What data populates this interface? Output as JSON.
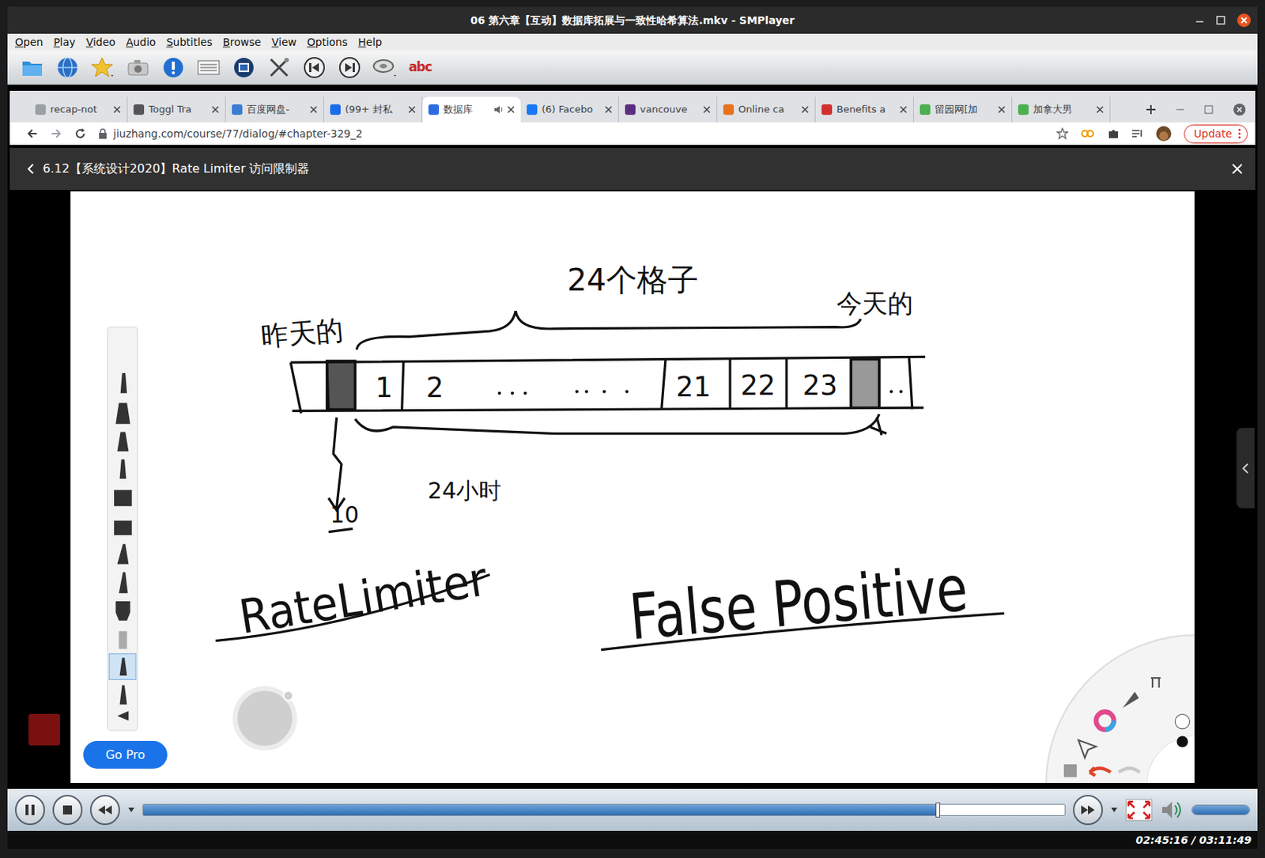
{
  "window": {
    "title": "06 第六章【互动】数据库拓展与一致性哈希算法.mkv - SMPlayer"
  },
  "menu": [
    "Open",
    "Play",
    "Video",
    "Audio",
    "Subtitles",
    "Browse",
    "View",
    "Options",
    "Help"
  ],
  "toolbar": {
    "subtitle_icon_text": "abc"
  },
  "browser": {
    "tabs": [
      {
        "label": "recap-not",
        "selected": false,
        "audio": false,
        "color": "#9aa0a6"
      },
      {
        "label": "Toggl Tra",
        "selected": false,
        "audio": false,
        "color": "#555555"
      },
      {
        "label": "百度网盘-",
        "selected": false,
        "audio": false,
        "color": "#3a7bd5"
      },
      {
        "label": "(99+ 封私",
        "selected": false,
        "audio": false,
        "color": "#1a6ce8"
      },
      {
        "label": "数据库",
        "selected": true,
        "audio": true,
        "color": "#2b6de0"
      },
      {
        "label": "(6) Facebo",
        "selected": false,
        "audio": false,
        "color": "#1877f2"
      },
      {
        "label": "vancouve",
        "selected": false,
        "audio": false,
        "color": "#5a2d82"
      },
      {
        "label": "Online ca",
        "selected": false,
        "audio": false,
        "color": "#e8711a"
      },
      {
        "label": "Benefits a",
        "selected": false,
        "audio": false,
        "color": "#d32f2f"
      },
      {
        "label": "留园网[加",
        "selected": false,
        "audio": false,
        "color": "#4caf50"
      },
      {
        "label": "加拿大男",
        "selected": false,
        "audio": false,
        "color": "#4caf50"
      }
    ],
    "url": "jiuzhang.com/course/77/dialog/#chapter-329_2",
    "update_button": "Update"
  },
  "course": {
    "title": "6.12【系统设计2020】Rate Limiter 访问限制器"
  },
  "whiteboard": {
    "top_label": "24个格子",
    "left_label": "昨天的",
    "right_label": "今天的",
    "bottom_label": "24小时",
    "count_label": "10",
    "cells": [
      "1",
      "2",
      "21",
      "22",
      "23"
    ],
    "title_left": "RateLimiter",
    "title_right": "False Positive",
    "go_pro": "Go Pro"
  },
  "player": {
    "playing": true,
    "progress": {
      "level": 0.862
    },
    "volume": {
      "level": 1.0
    },
    "time": "02:45:16 / 03:11:49"
  }
}
